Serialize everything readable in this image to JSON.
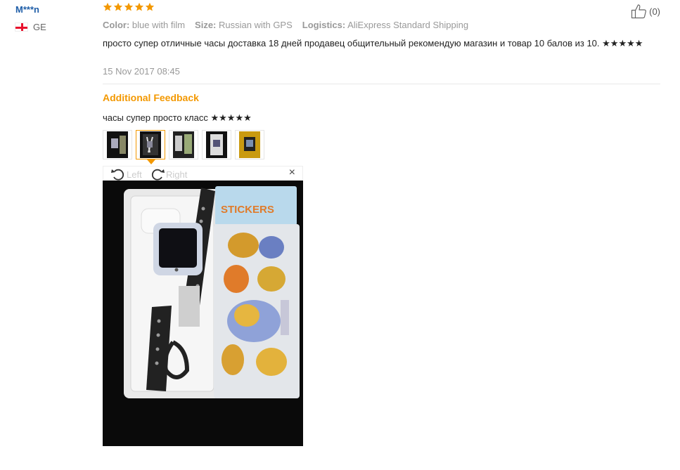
{
  "reviewer": {
    "name": "M***n",
    "country_code": "GE",
    "flag_icon": "georgia-flag-icon"
  },
  "rating": {
    "stars": 5,
    "max": 5,
    "color": "#f39800"
  },
  "helpful": {
    "count": "(0)",
    "icon": "thumbs-up-icon"
  },
  "meta": {
    "color_label": "Color:",
    "color_value": "blue with film",
    "size_label": "Size:",
    "size_value": "Russian with GPS",
    "logistics_label": "Logistics:",
    "logistics_value": "AliExpress Standard Shipping"
  },
  "review_text": "просто супер отличные часы доставка 18 дней продавец общительный рекомендую магазин и товар 10 балов из 10. ★★★★★",
  "review_date": "15 Nov 2017 08:45",
  "additional_feedback": {
    "title": "Additional Feedback",
    "text": "часы супер просто класс ★★★★★"
  },
  "thumbnails": {
    "count": 5,
    "active_index": 1
  },
  "viewer": {
    "rotate_left_label": "Left",
    "rotate_right_label": "Right",
    "close_symbol": "×"
  },
  "colors": {
    "accent": "#f39800",
    "link": "#1f5ea8",
    "muted": "#999999"
  }
}
